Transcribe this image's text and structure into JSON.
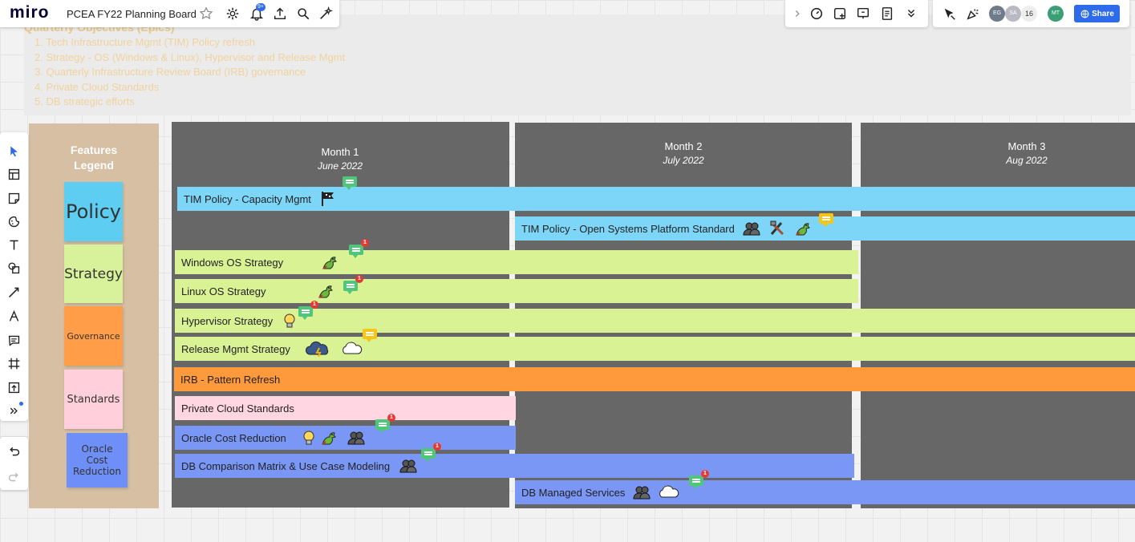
{
  "app": {
    "logo": "miro",
    "board_title": "PCEA FY22 Planning Board",
    "notifications_badge": "9+"
  },
  "objectives": {
    "title": "Quarterly Objectives (Epics)",
    "items": [
      "1.  Tech Infrastructure Mgmt (TIM) Policy refresh",
      "2.  Strategy - OS (Windows & Linux), Hypervisor and Release Mgmt",
      "3.  Quarterly Infrastructure Review Board (IRB) governance",
      "4.  Private Cloud Standards",
      "5. DB strategic efforts"
    ]
  },
  "legend": {
    "title_line1": "Features",
    "title_line2": "Legend",
    "items": [
      {
        "label": "Policy",
        "color": "#5ecdf2"
      },
      {
        "label": "Strategy",
        "color": "#d7f29a"
      },
      {
        "label": "Governance",
        "color": "#ff9d48"
      },
      {
        "label": "Standards",
        "color": "#ffd0dc"
      },
      {
        "label": "Oracle Cost Reduction",
        "color": "#6e8ff7"
      }
    ]
  },
  "months": [
    {
      "label": "Month 1",
      "sub": "June 2022"
    },
    {
      "label": "Month 2",
      "sub": "July 2022"
    },
    {
      "label": "Month 3",
      "sub": "Aug 2022"
    }
  ],
  "bars": [
    {
      "label": "TIM Policy - Capacity Mgmt",
      "color": "#7dd6f7",
      "icons": [
        "flag-icon"
      ]
    },
    {
      "label": "TIM Policy - Open Systems Platform Standard",
      "color": "#7dd6f7",
      "icons": [
        "people-icon",
        "tools-icon",
        "dragon-icon"
      ]
    },
    {
      "label": "Windows OS Strategy",
      "color": "#d8f294",
      "icons": [
        "dragon-icon"
      ]
    },
    {
      "label": "Linux OS Strategy",
      "color": "#d8f294",
      "icons": [
        "dragon-icon"
      ]
    },
    {
      "label": "Hypervisor Strategy",
      "color": "#d8f294",
      "icons": [
        "lightbulb-icon"
      ]
    },
    {
      "label": "Release Mgmt Strategy",
      "color": "#d8f294",
      "icons": [
        "storm-cloud-icon",
        "cloud-icon"
      ]
    },
    {
      "label": "IRB - Pattern Refresh",
      "color": "#ff9a3c",
      "icons": []
    },
    {
      "label": "Private Cloud Standards",
      "color": "#ffd6e2",
      "icons": []
    },
    {
      "label": "Oracle Cost Reduction",
      "color": "#7b97f6",
      "icons": [
        "lightbulb-icon",
        "dragon-icon",
        "people-icon"
      ]
    },
    {
      "label": "DB Comparison Matrix & Use Case Modeling",
      "color": "#7b97f6",
      "icons": [
        "people-icon"
      ]
    },
    {
      "label": "DB Managed Services",
      "color": "#7b97f6",
      "icons": [
        "people-icon",
        "cloud-icon"
      ]
    }
  ],
  "comment_badges": [
    "1",
    "1",
    "1",
    "1",
    "1",
    "1"
  ],
  "collaborators": {
    "avatars": [
      "EG",
      "SA"
    ],
    "count": "16",
    "me": "MT"
  },
  "share_label": "Share",
  "colors": {
    "accent": "#2d6bea",
    "comment_green": "#4fc67a",
    "comment_yellow": "#f5c518"
  }
}
